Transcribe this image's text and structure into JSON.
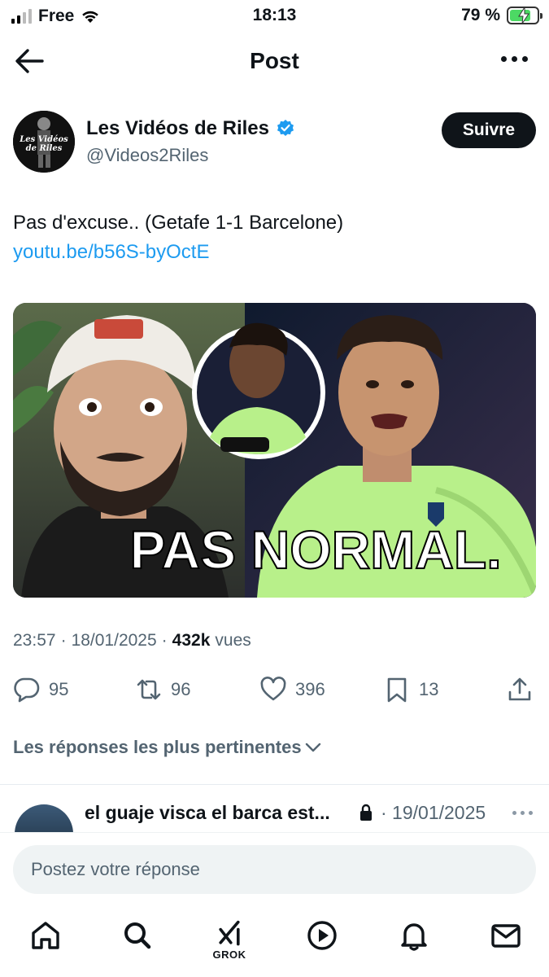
{
  "status_bar": {
    "carrier": "Free",
    "time": "18:13",
    "battery": "79 %",
    "battery_level": 0.79
  },
  "header": {
    "title": "Post"
  },
  "post": {
    "author": {
      "name": "Les Vidéos de Riles",
      "handle": "@Videos2Riles",
      "avatar_text": "Les Vidéos de Riles",
      "verified": true
    },
    "follow_label": "Suivre",
    "text": "Pas d'excuse.. (Getafe 1-1 Barcelone)",
    "link": "youtu.be/b56S-byOctE",
    "thumbnail_caption": "PAS NORMAL.",
    "time": "23:57",
    "date": "18/01/2025",
    "views_count": "432k",
    "views_label": "vues",
    "stats": {
      "replies": "95",
      "reposts": "96",
      "likes": "396",
      "bookmarks": "13"
    }
  },
  "replies_section": {
    "sort_label": "Les réponses les plus pertinentes"
  },
  "reply": {
    "name": "el guaje visca el barca est...",
    "date": "· 19/01/2025"
  },
  "compose": {
    "placeholder": "Postez votre réponse"
  },
  "tabbar": {
    "grok_label": "GROK"
  },
  "colors": {
    "link": "#1d9bf0",
    "verified": "#1d9bf0",
    "jersey": "#b8f08a",
    "battery": "#4cd964"
  }
}
